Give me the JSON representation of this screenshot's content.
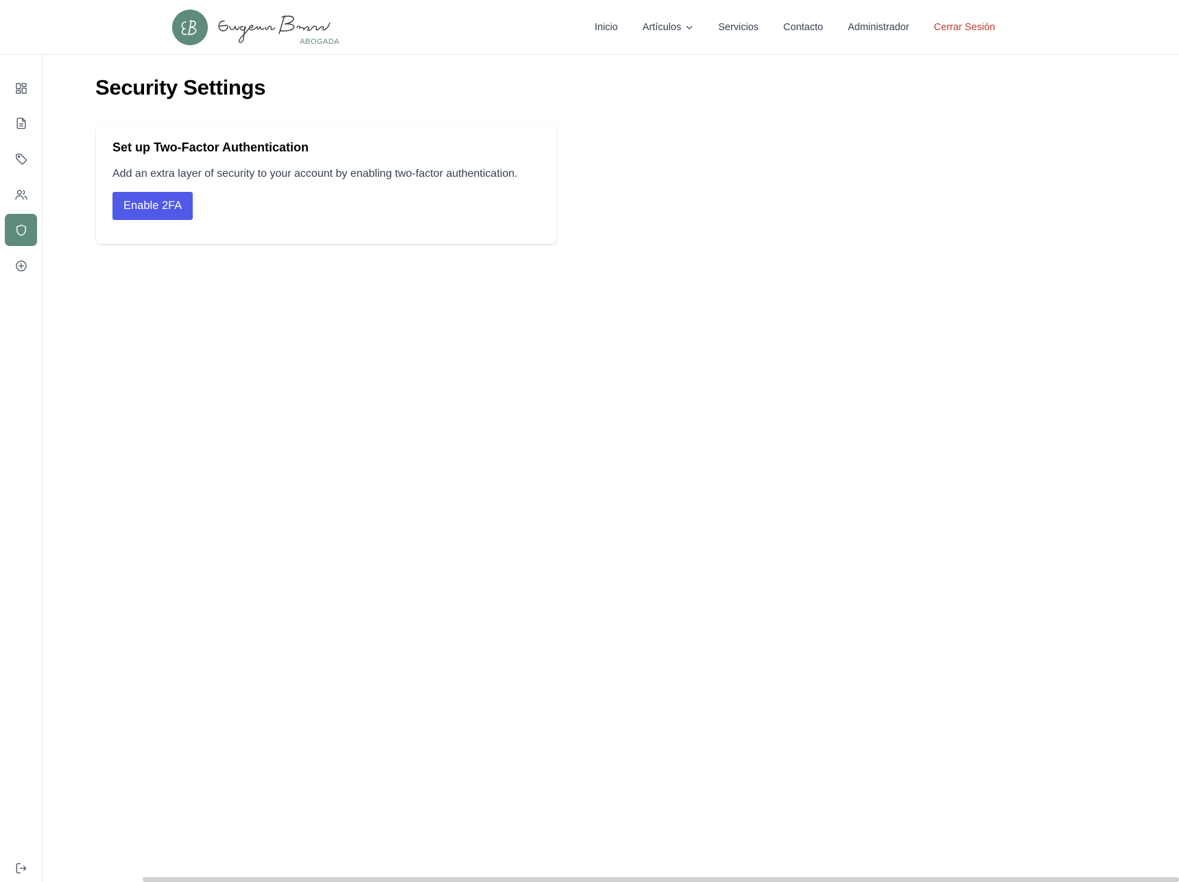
{
  "header": {
    "logo": {
      "monogram": "EB",
      "name": "Eugenia Bravo",
      "subtitle": "ABOGADA"
    },
    "nav": [
      {
        "label": "Inicio"
      },
      {
        "label": "Artículos",
        "has_dropdown": true
      },
      {
        "label": "Servicios"
      },
      {
        "label": "Contacto"
      },
      {
        "label": "Administrador"
      },
      {
        "label": "Cerrar Sesión"
      }
    ]
  },
  "sidebar": {
    "items": [
      {
        "icon": "dashboard-icon"
      },
      {
        "icon": "document-icon"
      },
      {
        "icon": "tag-icon"
      },
      {
        "icon": "users-icon"
      },
      {
        "icon": "shield-icon",
        "active": true
      },
      {
        "icon": "plus-circle-icon"
      }
    ],
    "footer_icon": "logout-icon"
  },
  "main": {
    "title": "Security Settings",
    "card": {
      "title": "Set up Two-Factor Authentication",
      "description": "Add an extra layer of security to your account by enabling two-factor authentication.",
      "button_label": "Enable 2FA"
    }
  },
  "colors": {
    "brand": "#5f8b7d",
    "primary_button": "#5059e8",
    "logout_link": "#c0392b"
  }
}
